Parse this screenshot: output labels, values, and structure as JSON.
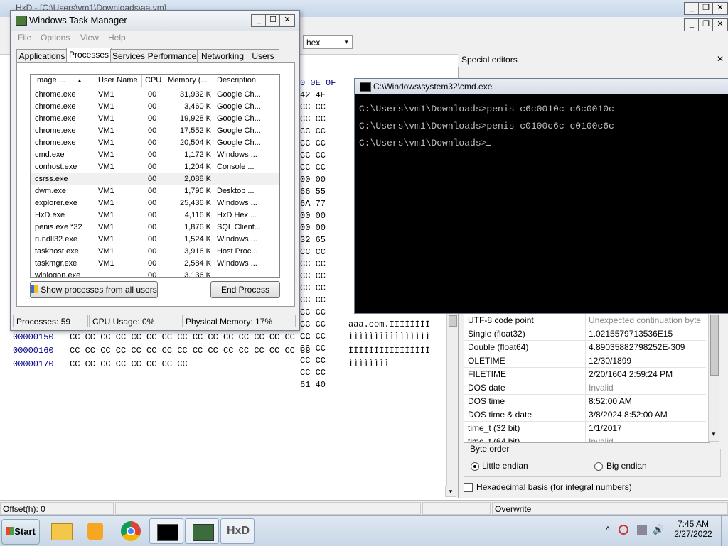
{
  "hxd": {
    "title": "HxD - [C:\\Users\\vm1\\Downloads\\aa.vm]",
    "datatype": "hex",
    "hex_rows": [
      {
        "offset": "00000150",
        "bytes": "CC CC CC CC CC CC CC CC CC CC CC CC CC CC CC CC",
        "text": "ÌÌÌÌÌÌÌÌÌÌÌÌÌÌÌÌ"
      },
      {
        "offset": "00000160",
        "bytes": "CC CC CC CC CC CC CC CC CC CC CC CC CC CC CC CC",
        "text": "ÌÌÌÌÌÌÌÌÌÌÌÌÌÌÌÌ"
      },
      {
        "offset": "00000170",
        "bytes": "CC CC CC CC CC CC CC CC",
        "text": "ÌÌÌÌÌÌÌÌ"
      }
    ],
    "partial_hex_col": [
      "0 0E 0F",
      "42 4E",
      "CC CC",
      "CC CC",
      "CC CC",
      "CC CC",
      "CC CC",
      "CC CC",
      "00 00",
      "66 55",
      "6A 77",
      "00 00",
      "00 00",
      "32 65",
      "CC CC",
      "CC CC",
      "CC CC",
      "CC CC",
      "CC CC",
      "CC CC",
      "CC CC",
      "CC CC",
      "CC CC",
      "CC CC",
      "CC CC",
      "61 40"
    ],
    "partial_text_rows": [
      "aaa.com.ÌÌÌÌÌÌÌÌ"
    ],
    "status": {
      "offset": "Offset(h): 0",
      "mode": "Overwrite"
    }
  },
  "special_editors": {
    "title": "Special editors",
    "rows": [
      {
        "key": "UTF-8 code point",
        "value": "Unexpected continuation byte",
        "grey": true
      },
      {
        "key": "Single (float32)",
        "value": "1.0215579713536E15",
        "grey": false
      },
      {
        "key": "Double (float64)",
        "value": "4.89035882798252E-309",
        "grey": false
      },
      {
        "key": "OLETIME",
        "value": "12/30/1899",
        "grey": false
      },
      {
        "key": "FILETIME",
        "value": "2/20/1604 2:59:24 PM",
        "grey": false
      },
      {
        "key": "DOS date",
        "value": "Invalid",
        "grey": true
      },
      {
        "key": "DOS time",
        "value": "8:52:00 AM",
        "grey": false
      },
      {
        "key": "DOS time & date",
        "value": "3/8/2024 8:52:00 AM",
        "grey": false
      },
      {
        "key": "time_t (32 bit)",
        "value": "1/1/2017",
        "grey": false
      },
      {
        "key": "time_t (64 bit)",
        "value": "Invalid",
        "grey": true
      }
    ],
    "byte_order_label": "Byte order",
    "little_endian": "Little endian",
    "big_endian": "Big endian",
    "hex_basis": "Hexadecimal basis (for integral numbers)"
  },
  "taskmgr": {
    "title": "Windows Task Manager",
    "menu": [
      "File",
      "Options",
      "View",
      "Help"
    ],
    "tabs": [
      "Applications",
      "Processes",
      "Services",
      "Performance",
      "Networking",
      "Users"
    ],
    "columns": [
      "Image ...",
      "User Name",
      "CPU",
      "Memory (...",
      "Description"
    ],
    "processes": [
      {
        "image": "chrome.exe",
        "user": "VM1",
        "cpu": "00",
        "mem": "31,932 K",
        "desc": "Google Ch..."
      },
      {
        "image": "chrome.exe",
        "user": "VM1",
        "cpu": "00",
        "mem": "3,460 K",
        "desc": "Google Ch..."
      },
      {
        "image": "chrome.exe",
        "user": "VM1",
        "cpu": "00",
        "mem": "19,928 K",
        "desc": "Google Ch..."
      },
      {
        "image": "chrome.exe",
        "user": "VM1",
        "cpu": "00",
        "mem": "17,552 K",
        "desc": "Google Ch..."
      },
      {
        "image": "chrome.exe",
        "user": "VM1",
        "cpu": "00",
        "mem": "20,504 K",
        "desc": "Google Ch..."
      },
      {
        "image": "cmd.exe",
        "user": "VM1",
        "cpu": "00",
        "mem": "1,172 K",
        "desc": "Windows ..."
      },
      {
        "image": "conhost.exe",
        "user": "VM1",
        "cpu": "00",
        "mem": "1,204 K",
        "desc": "Console ..."
      },
      {
        "image": "csrss.exe",
        "user": "",
        "cpu": "00",
        "mem": "2,088 K",
        "desc": ""
      },
      {
        "image": "dwm.exe",
        "user": "VM1",
        "cpu": "00",
        "mem": "1,796 K",
        "desc": "Desktop ..."
      },
      {
        "image": "explorer.exe",
        "user": "VM1",
        "cpu": "00",
        "mem": "25,436 K",
        "desc": "Windows ..."
      },
      {
        "image": "HxD.exe",
        "user": "VM1",
        "cpu": "00",
        "mem": "4,116 K",
        "desc": "HxD Hex ..."
      },
      {
        "image": "penis.exe *32",
        "user": "VM1",
        "cpu": "00",
        "mem": "1,876 K",
        "desc": "SQL Client..."
      },
      {
        "image": "rundll32.exe",
        "user": "VM1",
        "cpu": "00",
        "mem": "1,524 K",
        "desc": "Windows ..."
      },
      {
        "image": "taskhost.exe",
        "user": "VM1",
        "cpu": "00",
        "mem": "3,916 K",
        "desc": "Host Proc..."
      },
      {
        "image": "taskmgr.exe",
        "user": "VM1",
        "cpu": "00",
        "mem": "2,584 K",
        "desc": "Windows ..."
      },
      {
        "image": "winlogon.exe",
        "user": "",
        "cpu": "00",
        "mem": "3,136 K",
        "desc": ""
      }
    ],
    "show_all_btn": "Show processes from all users",
    "end_process_btn": "End Process",
    "status": {
      "processes": "Processes: 59",
      "cpu": "CPU Usage: 0%",
      "memory": "Physical Memory: 17%"
    }
  },
  "cmd": {
    "title": "C:\\Windows\\system32\\cmd.exe",
    "lines": [
      "C:\\Users\\vm1\\Downloads>penis c6c0010c c6c0010c",
      "C:\\Users\\vm1\\Downloads>penis c0100c6c c0100c6c",
      "C:\\Users\\vm1\\Downloads>"
    ]
  },
  "taskbar": {
    "start": "Start",
    "time": "7:45 AM",
    "date": "2/27/2022"
  }
}
